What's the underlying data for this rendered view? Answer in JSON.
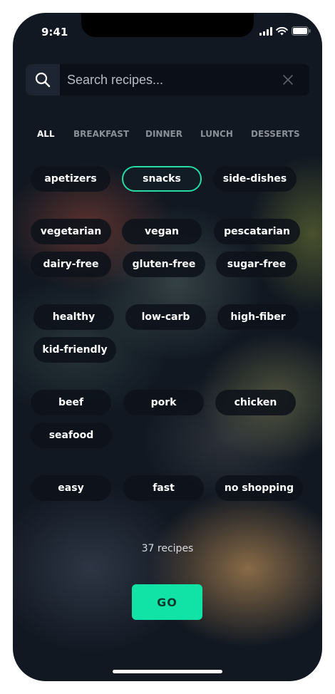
{
  "status_bar": {
    "time": "9:41"
  },
  "search": {
    "placeholder": "Search recipes..."
  },
  "tabs": [
    {
      "label": "ALL"
    },
    {
      "label": "BREAKFAST"
    },
    {
      "label": "DINNER"
    },
    {
      "label": "LUNCH"
    },
    {
      "label": "DESSERTS"
    }
  ],
  "chips": [
    {
      "label": "apetizers"
    },
    {
      "label": "snacks"
    },
    {
      "label": "side-dishes"
    },
    {
      "label": "vegetarian"
    },
    {
      "label": "vegan"
    },
    {
      "label": "pescatarian"
    },
    {
      "label": "dairy-free"
    },
    {
      "label": "gluten-free"
    },
    {
      "label": "sugar-free"
    },
    {
      "label": "healthy"
    },
    {
      "label": "low-carb"
    },
    {
      "label": "high-fiber"
    },
    {
      "label": "kid-friendly"
    },
    {
      "label": "beef"
    },
    {
      "label": "pork"
    },
    {
      "label": "chicken"
    },
    {
      "label": "seafood"
    },
    {
      "label": "easy"
    },
    {
      "label": "fast"
    },
    {
      "label": "no shopping"
    }
  ],
  "results": {
    "count_text": "37 recipes"
  },
  "go_button": {
    "label": "GO"
  },
  "colors": {
    "accent": "#10e3a5",
    "selected_border": "#27dba4"
  }
}
